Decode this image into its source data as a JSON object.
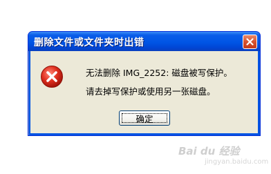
{
  "dialog": {
    "title": "删除文件或文件夹时出错",
    "message_line1": "无法删除 IMG_2252: 磁盘被写保护。",
    "message_line2": "请去掉写保护或使用另一张磁盘。",
    "ok_label": "确定",
    "icon": "error-icon",
    "close_icon": "close-icon"
  },
  "watermark": {
    "text": "Bai du 经验",
    "sub": "jingyan.baidu.com"
  },
  "colors": {
    "titlebar": "#0055e5",
    "client": "#ece9d8",
    "close_button": "#d8522e",
    "error_icon": "#d52b1e"
  }
}
